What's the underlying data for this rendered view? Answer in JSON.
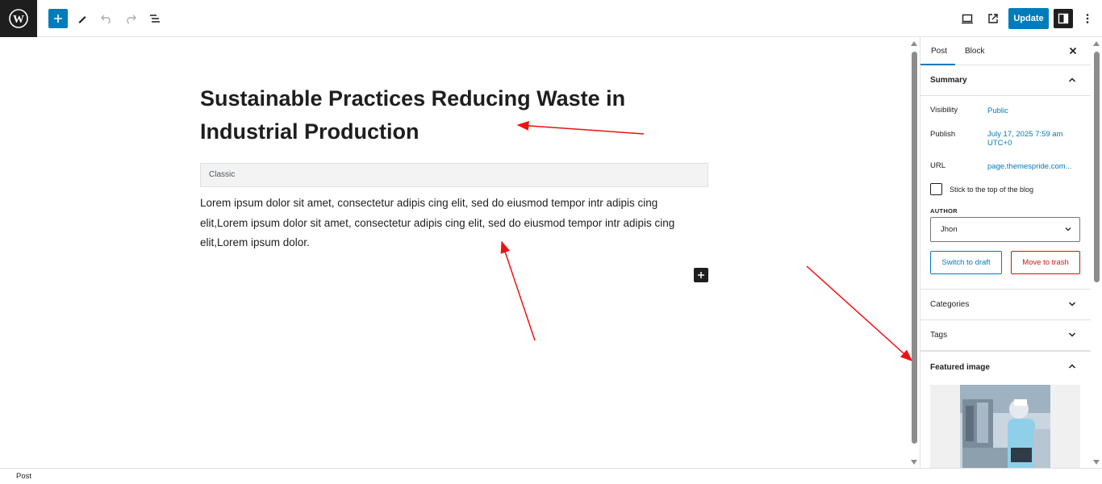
{
  "toolbar": {
    "logo_icon": "wordpress-icon",
    "add_icon": "plus-icon",
    "tools_icon": "pencil-icon",
    "undo_icon": "undo-icon",
    "redo_icon": "redo-icon",
    "outline_icon": "list-view-icon",
    "preview_icon": "desktop-icon",
    "view_icon": "external-link-icon",
    "update_label": "Update",
    "settings_icon": "sidebar-icon",
    "options_icon": "more-vertical-icon",
    "accent_color": "#007cba"
  },
  "editor": {
    "title": "Sustainable Practices Reducing Waste in Industrial Production",
    "classic_label": "Classic",
    "body": "Lorem ipsum dolor sit amet, consectetur adipis cing elit, sed do eiusmod tempor intr adipis cing elit,Lorem ipsum dolor sit amet, consectetur adipis cing elit, sed do eiusmod tempor intr adipis cing elit,Lorem ipsum dolor.",
    "annotation_color": "#ee1111"
  },
  "sidebar": {
    "tabs": [
      {
        "label": "Post",
        "active": true
      },
      {
        "label": "Block",
        "active": false
      }
    ],
    "summary": {
      "heading": "Summary",
      "visibility_label": "Visibility",
      "visibility_value": "Public",
      "publish_label": "Publish",
      "publish_value_line1": "July 17, 2025 7:59 am",
      "publish_value_line2": "UTC+0",
      "url_label": "URL",
      "url_value": "page.themespride.com...",
      "sticky_label": "Stick to the top of the blog",
      "author_label": "AUTHOR",
      "author_value": "Jhon",
      "switch_draft_label": "Switch to draft",
      "trash_label": "Move to trash"
    },
    "panels": [
      {
        "label": "Categories",
        "expanded": false
      },
      {
        "label": "Tags",
        "expanded": false
      },
      {
        "label": "Featured image",
        "expanded": true
      }
    ]
  },
  "statusbar": {
    "label": "Post"
  }
}
